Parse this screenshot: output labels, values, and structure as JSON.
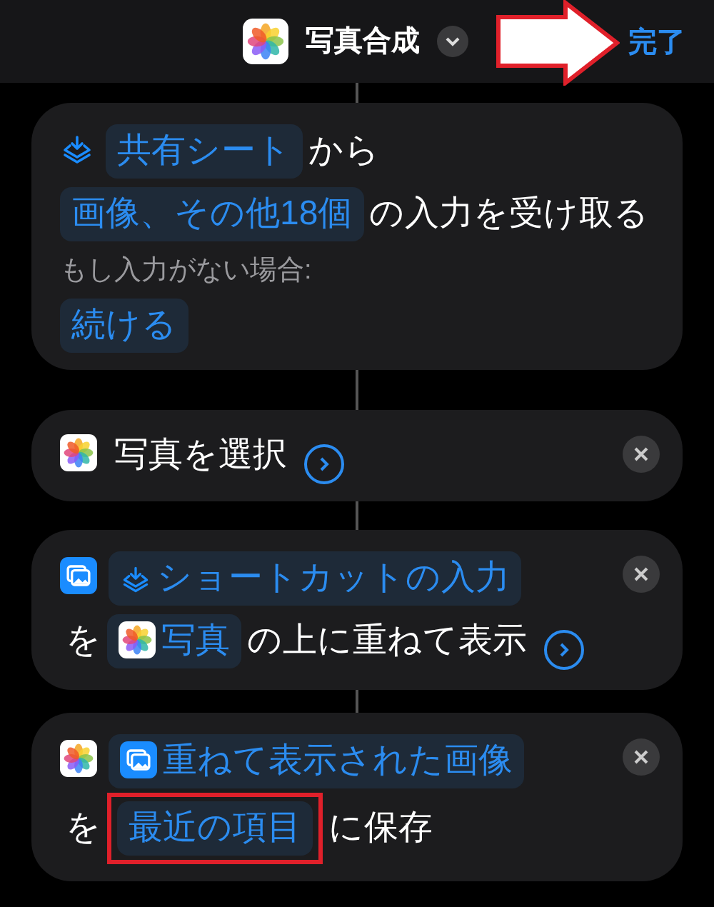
{
  "header": {
    "title": "写真合成",
    "done": "完了",
    "annotation_arrow": true
  },
  "actions": [
    {
      "kind": "receive",
      "closable": false,
      "detail": false,
      "lines": [
        [
          {
            "kind": "token",
            "text": "共有シート",
            "highlighted": false
          },
          {
            "kind": "text",
            "text": "から"
          },
          {
            "kind": "token",
            "text": "画像、その他18個",
            "highlighted": false
          },
          {
            "kind": "text",
            "text": "の入力を受け取る"
          }
        ]
      ],
      "fallback_label": "もし入力がない場合:",
      "fallback_value": "続ける"
    },
    {
      "kind": "photos",
      "closable": true,
      "detail": true,
      "lines": [
        [
          {
            "kind": "text",
            "text": "写真を選択"
          }
        ]
      ]
    },
    {
      "kind": "overlay",
      "closable": true,
      "detail": true,
      "lines": [
        [
          {
            "kind": "input_token",
            "text": "ショートカットの入力",
            "highlighted": false
          }
        ],
        [
          {
            "kind": "text",
            "text": "を"
          },
          {
            "kind": "photos_token",
            "text": "写真",
            "highlighted": false
          },
          {
            "kind": "text",
            "text": "の上に重ねて表示"
          }
        ]
      ]
    },
    {
      "kind": "photos",
      "closable": true,
      "detail": false,
      "lines": [
        [
          {
            "kind": "image_token",
            "text": "重ねて表示された画像",
            "highlighted": false
          }
        ],
        [
          {
            "kind": "text",
            "text": "を"
          },
          {
            "kind": "token",
            "text": "最近の項目",
            "highlighted": true
          },
          {
            "kind": "text",
            "text": "に保存"
          }
        ]
      ]
    }
  ]
}
